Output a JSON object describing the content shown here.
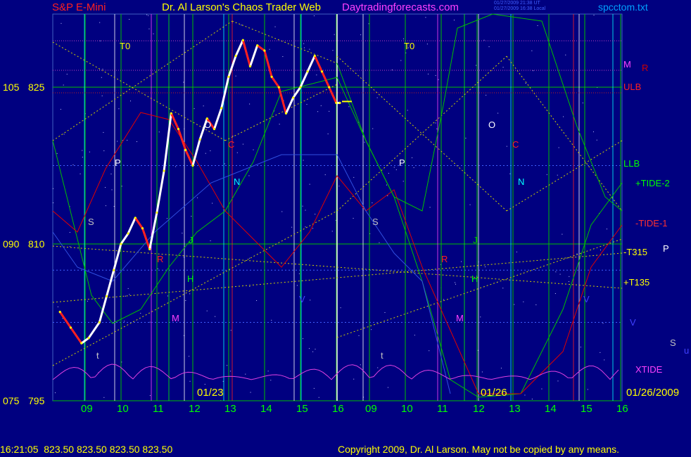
{
  "header": {
    "instrument": "S&P E-Mini",
    "title": "Dr. Al Larson's Chaos Trader Web",
    "site": "Daytradingforecasts.com",
    "timestamp_line1": "01/27/2009 21:38 UT",
    "timestamp_line2": "01/27/2009 16:38 Local",
    "filename": "spcctom.txt"
  },
  "footer": {
    "quote": "16:21:05  823.50 823.50 823.50 823.50",
    "copyright": "Copyright 2009, Dr. Al Larson. May not be copied by any means."
  },
  "colors": {
    "background": "#000080",
    "price_up": "#ffffff",
    "price_down": "#ff2020",
    "grid_green": "#00c000",
    "cyan": "#00ffff",
    "magenta": "#ff40ff",
    "yellow": "#ffff00"
  },
  "chart_data": {
    "type": "line",
    "title": "S&P E-Mini",
    "y_left_labels": [
      {
        "primary": "105",
        "secondary": "825",
        "value": 825
      },
      {
        "primary": "090",
        "secondary": "810",
        "value": 810
      },
      {
        "primary": "075",
        "secondary": "795",
        "value": 795
      }
    ],
    "ylim": [
      795,
      832
    ],
    "x_tick_labels": [
      "09",
      "10",
      "11",
      "12",
      "13",
      "14",
      "15",
      "16",
      "09",
      "10",
      "11",
      "12",
      "13",
      "14",
      "15",
      "16"
    ],
    "date_labels": [
      "01/23",
      "01/26",
      "01/26/2009"
    ],
    "last_price": 823.5,
    "right_labels": [
      {
        "text": "M",
        "color": "#ff40ff"
      },
      {
        "text": "R",
        "color": "#d00000"
      },
      {
        "text": "ULB",
        "color": "#ff2020"
      },
      {
        "text": "LLB",
        "color": "#00ff00"
      },
      {
        "text": "+TIDE-2",
        "color": "#00ff00"
      },
      {
        "text": "-TIDE-1",
        "color": "#ff3030"
      },
      {
        "text": "-T315",
        "color": "#ffff00"
      },
      {
        "text": "P",
        "color": "#ffffff"
      },
      {
        "text": "+T135",
        "color": "#ffff00"
      },
      {
        "text": "V",
        "color": "#4040ff"
      },
      {
        "text": "S",
        "color": "#c0c0c0"
      },
      {
        "text": "u",
        "color": "#4040ff"
      },
      {
        "text": "XTIDE",
        "color": "#ff40ff"
      }
    ],
    "event_markers": [
      {
        "text": "T0",
        "color": "#ffff00",
        "day": 1
      },
      {
        "text": "O",
        "color": "#ffffff",
        "day": 1
      },
      {
        "text": "P",
        "color": "#ffffff",
        "day": 1
      },
      {
        "text": "C",
        "color": "#ff2020",
        "day": 1
      },
      {
        "text": "N",
        "color": "#00ffff",
        "day": 1
      },
      {
        "text": "S",
        "color": "#c0c0c0",
        "day": 1
      },
      {
        "text": "J",
        "color": "#00ff00",
        "day": 1
      },
      {
        "text": "R",
        "color": "#ff2020",
        "day": 1
      },
      {
        "text": "H",
        "color": "#00ff00",
        "day": 1
      },
      {
        "text": "M",
        "color": "#ff40ff",
        "day": 1
      },
      {
        "text": "V",
        "color": "#4040ff",
        "day": 1
      },
      {
        "text": "t",
        "color": "#c0c0c0",
        "day": 1
      },
      {
        "text": "T0",
        "color": "#ffff00",
        "day": 2
      },
      {
        "text": "O",
        "color": "#ffffff",
        "day": 2
      },
      {
        "text": "P",
        "color": "#ffffff",
        "day": 2
      },
      {
        "text": "C",
        "color": "#ff2020",
        "day": 2
      },
      {
        "text": "N",
        "color": "#00ffff",
        "day": 2
      },
      {
        "text": "S",
        "color": "#c0c0c0",
        "day": 2
      },
      {
        "text": "J",
        "color": "#00c000",
        "day": 2
      },
      {
        "text": "R",
        "color": "#ff2020",
        "day": 2
      },
      {
        "text": "H",
        "color": "#00ff00",
        "day": 2
      },
      {
        "text": "M",
        "color": "#ff40ff",
        "day": 2
      },
      {
        "text": "V",
        "color": "#4040ff",
        "day": 2
      },
      {
        "text": "t",
        "color": "#c0c0c0",
        "day": 2
      }
    ],
    "price_series": {
      "name": "",
      "x_hours": [
        8.2,
        8.5,
        8.8,
        9.0,
        9.3,
        9.5,
        9.7,
        9.9,
        10.1,
        10.3,
        10.5,
        10.7,
        10.9,
        11.1,
        11.3,
        11.5,
        11.7,
        11.9,
        12.1,
        12.3,
        12.5,
        12.7,
        12.9,
        13.1,
        13.3,
        13.5,
        13.7,
        13.9,
        14.1,
        14.3,
        14.5,
        14.7,
        14.9,
        15.1,
        15.3,
        15.5,
        15.7,
        15.9,
        16.0
      ],
      "values": [
        803.5,
        802,
        800.5,
        801,
        802.5,
        805,
        807.5,
        810,
        811,
        812.5,
        811.5,
        809.5,
        813,
        817,
        822.5,
        821,
        819,
        817.5,
        820,
        822,
        821,
        823,
        826,
        828,
        829.5,
        827,
        829,
        828.5,
        826,
        825,
        822.5,
        824,
        825,
        826.5,
        828,
        826.5,
        825,
        823.5,
        823.5
      ]
    }
  }
}
